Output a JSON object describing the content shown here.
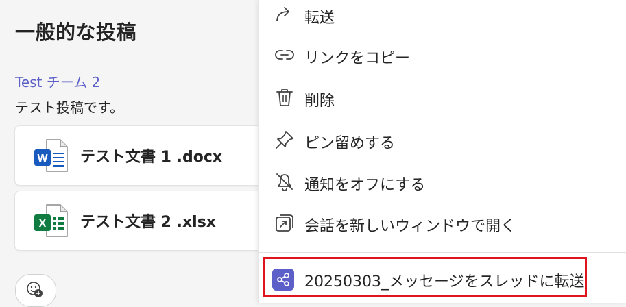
{
  "post": {
    "title": "一般的な投稿",
    "team_name": "Test チーム 2",
    "message": "テスト投稿です。",
    "files": [
      {
        "name": "テスト文書 1 .docx",
        "icon": "word-file-icon"
      },
      {
        "name": "テスト文書 2 .xlsx",
        "icon": "excel-file-icon"
      }
    ],
    "word_letter": "W",
    "excel_letter": "X"
  },
  "menu": {
    "items": [
      {
        "label": "転送",
        "icon": "forward-icon"
      },
      {
        "label": "リンクをコピー",
        "icon": "link-icon"
      },
      {
        "label": "削除",
        "icon": "trash-icon"
      },
      {
        "label": "ピン留めする",
        "icon": "pin-icon"
      },
      {
        "label": "通知をオフにする",
        "icon": "bell-off-icon"
      },
      {
        "label": "会話を新しいウィンドウで開く",
        "icon": "open-in-window-icon"
      }
    ],
    "workflow": {
      "label": "20250303_メッセージをスレッドに転送",
      "icon": "workflow-share-icon",
      "color": "#5b5fc7"
    }
  },
  "colors": {
    "accent": "#5b5fc7",
    "highlight": "#e0141c",
    "word": "#185abd",
    "excel": "#107c41"
  }
}
